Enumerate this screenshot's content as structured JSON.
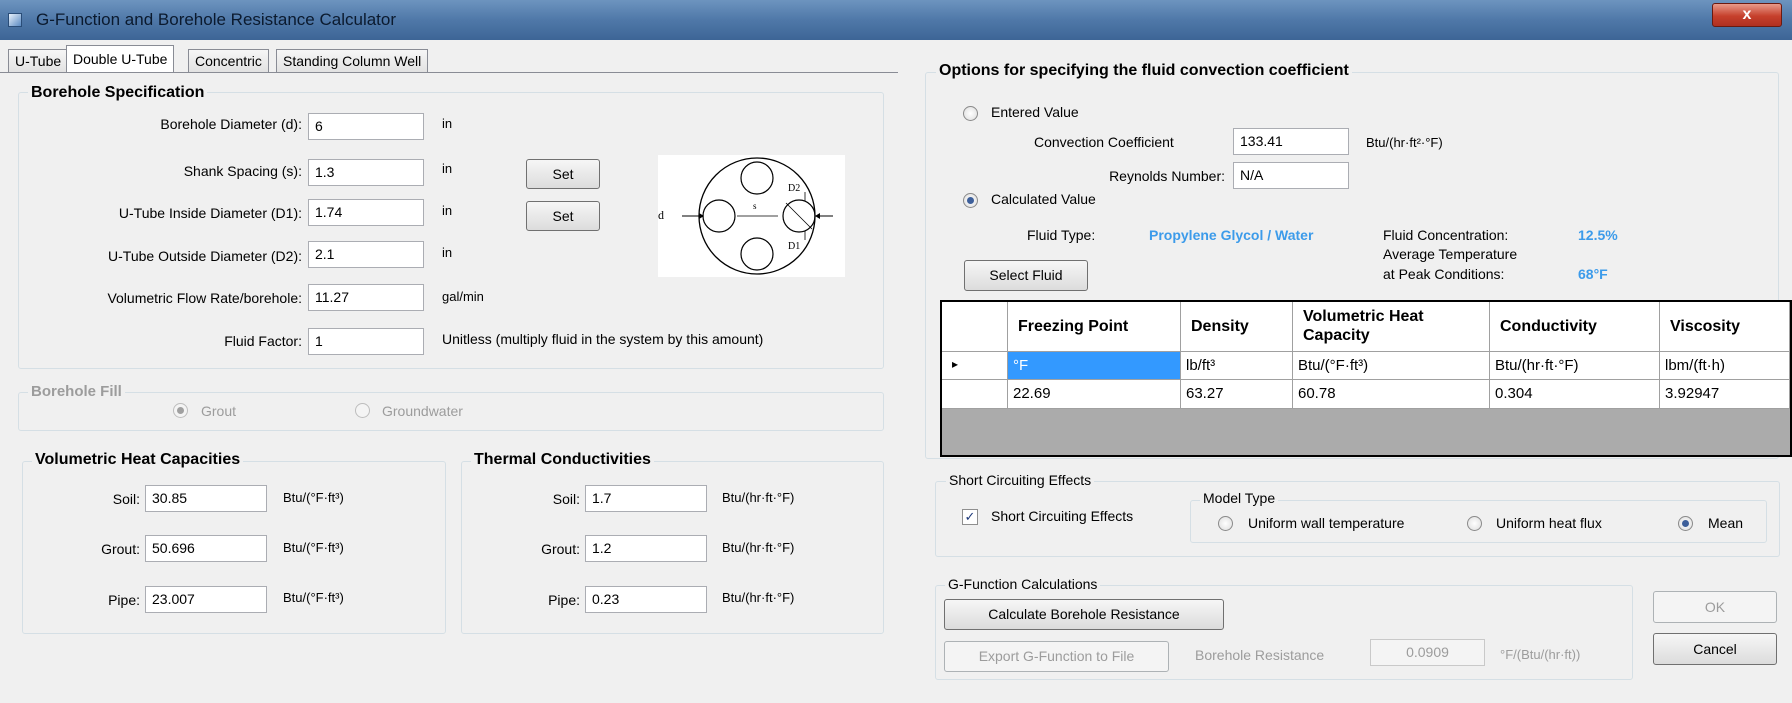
{
  "window": {
    "title": "G-Function and Borehole Resistance Calculator",
    "close_label": "x"
  },
  "tabs": [
    "U-Tube",
    "Double U-Tube",
    "Concentric",
    "Standing Column Well"
  ],
  "borehole_spec": {
    "title": "Borehole Specification",
    "rows": [
      {
        "label": "Borehole Diameter (d):",
        "value": "6",
        "unit": "in"
      },
      {
        "label": "Shank Spacing (s):",
        "value": "1.3",
        "unit": "in"
      },
      {
        "label": "U-Tube Inside Diameter (D1):",
        "value": "1.74",
        "unit": "in"
      },
      {
        "label": "U-Tube Outside Diameter (D2):",
        "value": "2.1",
        "unit": "in"
      },
      {
        "label": "Volumetric Flow Rate/borehole:",
        "value": "11.27",
        "unit": "gal/min"
      },
      {
        "label": "Fluid Factor:",
        "value": "1",
        "unit": "Unitless (multiply fluid in the system by this amount)"
      }
    ],
    "set_label": "Set",
    "diagram_labels": {
      "d": "d",
      "s": "s",
      "d2": "D2",
      "d1": "D1"
    }
  },
  "borehole_fill": {
    "title": "Borehole Fill",
    "options": [
      "Grout",
      "Groundwater"
    ],
    "selected": "Grout"
  },
  "heat_capacities": {
    "title": "Volumetric Heat Capacities",
    "rows": [
      {
        "label": "Soil:",
        "value": "30.85",
        "unit": "Btu/(°F·ft³)"
      },
      {
        "label": "Grout:",
        "value": "50.696",
        "unit": "Btu/(°F·ft³)"
      },
      {
        "label": "Pipe:",
        "value": "23.007",
        "unit": "Btu/(°F·ft³)"
      }
    ]
  },
  "conductivities": {
    "title": "Thermal Conductivities",
    "rows": [
      {
        "label": "Soil:",
        "value": "1.7",
        "unit": "Btu/(hr·ft·°F)"
      },
      {
        "label": "Grout:",
        "value": "1.2",
        "unit": "Btu/(hr·ft·°F)"
      },
      {
        "label": "Pipe:",
        "value": "0.23",
        "unit": "Btu/(hr·ft·°F)"
      }
    ]
  },
  "convection": {
    "title": "Options for specifying the fluid convection coefficient",
    "entered_label": "Entered Value",
    "coef_label": "Convection Coefficient",
    "coef_value": "133.41",
    "coef_unit": "Btu/(hr·ft²·°F)",
    "reynolds_label": "Reynolds Number:",
    "reynolds_value": "N/A",
    "calculated_label": "Calculated Value",
    "selected": "Calculated Value",
    "fluid_type_label": "Fluid Type:",
    "fluid_type_value": "Propylene Glycol / Water",
    "concentration_label": "Fluid Concentration:",
    "concentration_value": "12.5%",
    "avg_temp_label_1": "Average Temperature",
    "avg_temp_label_2": "at Peak Conditions:",
    "avg_temp_value": "68°F",
    "select_fluid_label": "Select Fluid"
  },
  "fluid_table": {
    "columns": [
      "Freezing Point",
      "Density",
      "Volumetric Heat Capacity",
      "Conductivity",
      "Viscosity"
    ],
    "rows": [
      [
        "°F",
        "lb/ft³",
        "Btu/(°F·ft³)",
        "Btu/(hr·ft·°F)",
        "lbm/(ft·h)"
      ],
      [
        "22.69",
        "63.27",
        "60.78",
        "0.304",
        "3.92947"
      ]
    ],
    "row_marker": "▸"
  },
  "short_circuit": {
    "title": "Short Circuiting Effects",
    "checkbox_label": "Short Circuiting Effects",
    "checked": true,
    "model_title": "Model Type",
    "models": [
      "Uniform wall temperature",
      "Uniform heat flux",
      "Mean"
    ],
    "selected": "Mean"
  },
  "gfunc": {
    "title": "G-Function Calculations",
    "calc_label": "Calculate Borehole Resistance",
    "export_label": "Export G-Function to File",
    "resistance_label": "Borehole Resistance",
    "resistance_value": "0.0909",
    "resistance_unit": "°F/(Btu/(hr·ft))"
  },
  "dialog": {
    "ok_label": "OK",
    "cancel_label": "Cancel"
  },
  "colors": {
    "accent_blue": "#3c9bea",
    "selected_cell": "#3399ff",
    "titlebar": "#4f78a8",
    "close": "#c6402c"
  }
}
